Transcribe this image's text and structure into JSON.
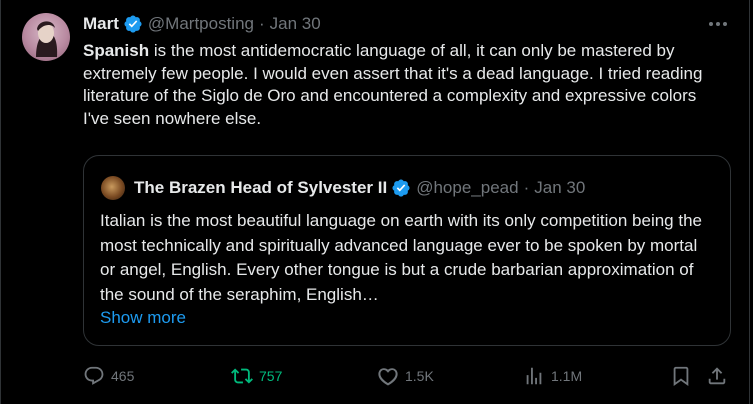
{
  "author": {
    "name": "Mart",
    "handle": "@Martposting",
    "date": "Jan 30"
  },
  "tweet": {
    "bold_lead": "Spanish",
    "text": " is the most antidemocratic language of all, it can only be mastered by extremely few people. I would even assert that it's a dead language. I tried reading literature of the Siglo de Oro and encountered a complexity and expressive colors I've seen nowhere else."
  },
  "quote": {
    "name": "The Brazen Head of Sylvester II",
    "handle": "@hope_pead",
    "date": "Jan 30",
    "text": "Italian is the most beautiful language on earth with its only competition being the most technically and spiritually advanced language ever to be spoken by mortal or angel, English. Every other tongue is but a crude barbarian approximation of the sound of the seraphim, English…",
    "show_more": "Show more"
  },
  "actions": {
    "replies": "465",
    "reposts": "757",
    "likes": "1.5K",
    "views": "1.1M"
  },
  "separator": "·",
  "colors": {
    "background": "#000000",
    "text": "#e7e9ea",
    "muted": "#71767b",
    "link": "#1d9bf0",
    "repost": "#00ba7c",
    "verified": "#1d9bf0"
  },
  "icons": [
    "more-icon",
    "verified-icon",
    "reply-icon",
    "repost-icon",
    "like-icon",
    "views-icon",
    "bookmark-icon",
    "share-icon"
  ]
}
